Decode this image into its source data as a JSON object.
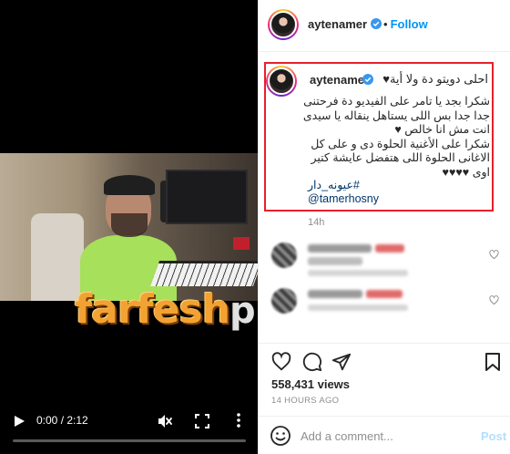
{
  "video": {
    "time_label": "0:00 / 2:12",
    "progress": 0,
    "watermark_main": "farfesh",
    "watermark_tail": "plus.com"
  },
  "post": {
    "header": {
      "username": "aytenamer",
      "follow_label": "Follow",
      "dot": "•"
    },
    "caption": {
      "username": "aytenamer",
      "first_line": "احلى دويتو دة ولا أية♥",
      "body_lines": [
        "شكرا بجد يا تامر على الفيديو دة فرحتنى",
        "جدا جدا بس اللى يستاهل ينقاله يا سيدى",
        "انت مش انا خالص ♥",
        "شكرا على الأغنية الحلوة دى و على كل",
        "الاغانى الحلوة اللى هتفضل عايشة كتير",
        "اوى ♥♥♥♥"
      ],
      "hashtag": "#عيونه_دار",
      "mention": "@tamerhosny",
      "time": "14h"
    },
    "views": "558,431 views",
    "date": "14 HOURS AGO",
    "comment_input": {
      "placeholder": "Add a comment...",
      "value": ""
    },
    "post_label": "Post"
  },
  "colors": {
    "accent": "#0095f6",
    "highlight_border": "#e8202b",
    "post_disabled": "#b2dffc",
    "watermark": "#f2a233"
  }
}
